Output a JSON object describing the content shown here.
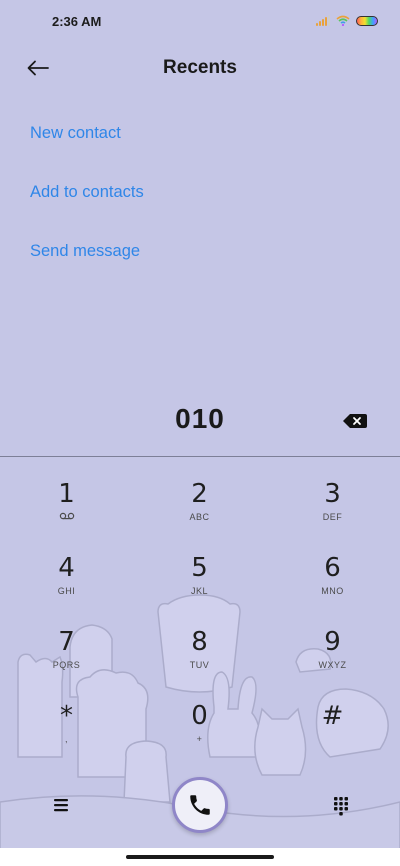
{
  "status_bar": {
    "time": "2:36 AM",
    "signal_icon": "signal-bars-icon",
    "wifi_icon": "wifi-icon",
    "battery_icon": "battery-icon"
  },
  "header": {
    "title": "Recents",
    "back_icon": "back-arrow-icon"
  },
  "actions": [
    {
      "label": "New contact"
    },
    {
      "label": "Add to contacts"
    },
    {
      "label": "Send message"
    }
  ],
  "dialer": {
    "number": "010",
    "delete_icon": "backspace-icon"
  },
  "keypad": [
    {
      "digit": "1",
      "letters": ""
    },
    {
      "digit": "2",
      "letters": "ABC"
    },
    {
      "digit": "3",
      "letters": "DEF"
    },
    {
      "digit": "4",
      "letters": "GHI"
    },
    {
      "digit": "5",
      "letters": "JKL"
    },
    {
      "digit": "6",
      "letters": "MNO"
    },
    {
      "digit": "7",
      "letters": "PQRS"
    },
    {
      "digit": "8",
      "letters": "TUV"
    },
    {
      "digit": "9",
      "letters": "WXYZ"
    },
    {
      "digit": "*",
      "letters": ","
    },
    {
      "digit": "0",
      "letters": "+"
    },
    {
      "digit": "#",
      "letters": ""
    }
  ],
  "bottom_bar": {
    "menu_icon": "menu-icon",
    "call_icon": "phone-icon",
    "dialpad_icon": "dialpad-grid-icon"
  },
  "colors": {
    "background": "#C5C6E6",
    "link": "#2F86E8",
    "call_ring": "#8F86C8"
  }
}
